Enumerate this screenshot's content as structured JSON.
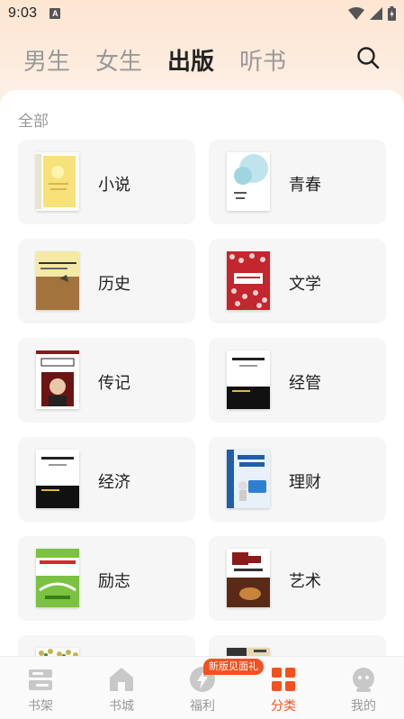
{
  "status_bar": {
    "time": "9:03",
    "notification_letter": "A"
  },
  "top_tabs": [
    {
      "label": "男生",
      "active": false
    },
    {
      "label": "女生",
      "active": false
    },
    {
      "label": "出版",
      "active": true
    },
    {
      "label": "听书",
      "active": false
    }
  ],
  "search_icon": "search-icon",
  "section_label": "全部",
  "categories": [
    {
      "label": "小说",
      "cover_color": "#f7e27a"
    },
    {
      "label": "青春",
      "cover_color": "#bfe4ec"
    },
    {
      "label": "历史",
      "cover_color": "#a3733d"
    },
    {
      "label": "文学",
      "cover_color": "#c3262c"
    },
    {
      "label": "传记",
      "cover_color": "#ffffff"
    },
    {
      "label": "经管",
      "cover_color": "#ffffff"
    },
    {
      "label": "经济",
      "cover_color": "#ffffff"
    },
    {
      "label": "理财",
      "cover_color": "#1f5fa8"
    },
    {
      "label": "励志",
      "cover_color": "#7cc242"
    },
    {
      "label": "艺术",
      "cover_color": "#5a2a18"
    },
    {
      "label": "",
      "cover_color": "#d8c060"
    },
    {
      "label": "",
      "cover_color": "#333333"
    }
  ],
  "bottom_nav": [
    {
      "label": "书架",
      "icon": "bookshelf-icon",
      "active": false
    },
    {
      "label": "书城",
      "icon": "bookstore-icon",
      "active": false
    },
    {
      "label": "福利",
      "icon": "bolt-icon",
      "active": false
    },
    {
      "label": "分类",
      "icon": "category-grid-icon",
      "active": true
    },
    {
      "label": "我的",
      "icon": "profile-icon",
      "active": false
    }
  ],
  "promo_badge": "新版见面礼",
  "colors": {
    "accent": "#f4511e",
    "inactive": "#999999",
    "card_bg": "#f6f6f6"
  }
}
